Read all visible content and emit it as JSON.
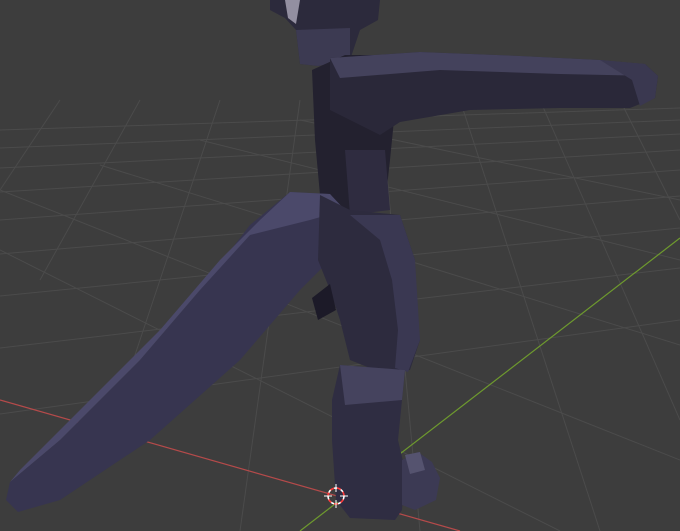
{
  "viewport": {
    "background_color": "#3d3d3d",
    "grid_color": "#4a4a4a",
    "x_axis_color": "#b54a4a",
    "y_axis_color": "#6e9a2e",
    "mesh_base_color": "#2a2838",
    "mesh_light_color": "#4a4a6a",
    "mesh_dark_color": "#1e1c2a",
    "cursor_icon": "3d-cursor-icon",
    "cursor_colors": [
      "#ff3b3b",
      "#ffffff"
    ]
  }
}
